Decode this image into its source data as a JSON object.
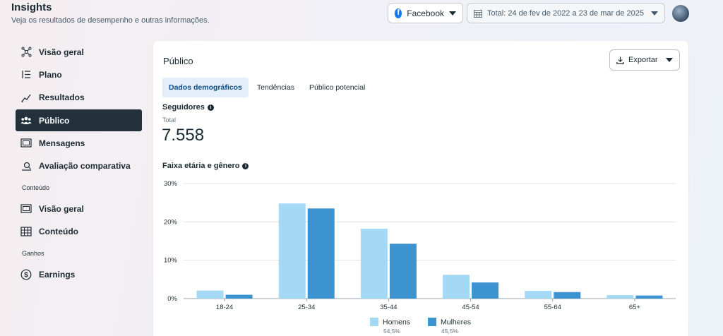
{
  "header": {
    "title": "Insights",
    "subtitle": "Veja os resultados de desempenho e outras informações."
  },
  "top_controls": {
    "platform": "Facebook",
    "date_range": "Total: 24 de fev de 2022 a 23 de mar de 2025"
  },
  "sidebar": {
    "items": [
      {
        "label": "Visão geral",
        "icon": "network-icon"
      },
      {
        "label": "Plano",
        "icon": "list-icon"
      },
      {
        "label": "Resultados",
        "icon": "trend-icon"
      },
      {
        "label": "Público",
        "icon": "people-icon",
        "active": true
      },
      {
        "label": "Mensagens",
        "icon": "messages-icon"
      },
      {
        "label": "Avaliação comparativa",
        "icon": "benchmark-icon"
      }
    ],
    "content_section": "Conteúdo",
    "content_items": [
      {
        "label": "Visão geral",
        "icon": "gallery-icon"
      },
      {
        "label": "Conteúdo",
        "icon": "table-icon"
      }
    ],
    "earnings_section": "Ganhos",
    "earnings_items": [
      {
        "label": "Earnings",
        "icon": "dollar-icon"
      }
    ]
  },
  "panel": {
    "title": "Público",
    "export_label": "Exportar",
    "tabs": [
      "Dados demográficos",
      "Tendências",
      "Público potencial"
    ],
    "followers_label": "Seguidores",
    "total_label": "Total",
    "total_value": "7.558",
    "age_gender_label": "Faixa etária e gênero"
  },
  "colors": {
    "men": "#a3d9f5",
    "women": "#3d93cf",
    "active_nav": "#23313d",
    "tab_active_bg": "#e3eefa"
  },
  "chart_data": {
    "type": "bar",
    "categories": [
      "18-24",
      "25-34",
      "35-44",
      "45-54",
      "55-64",
      "65+"
    ],
    "series": [
      {
        "name": "Homens",
        "pct": "54,5%",
        "values": [
          2.1,
          24.8,
          18.2,
          6.2,
          2.0,
          0.9
        ]
      },
      {
        "name": "Mulheres",
        "pct": "45,5%",
        "values": [
          1.0,
          23.5,
          14.3,
          4.2,
          1.7,
          0.8
        ]
      }
    ],
    "yticks": [
      "0%",
      "10%",
      "20%",
      "30%"
    ],
    "ylim": [
      0,
      30
    ],
    "grid": true,
    "legend": "bottom"
  }
}
